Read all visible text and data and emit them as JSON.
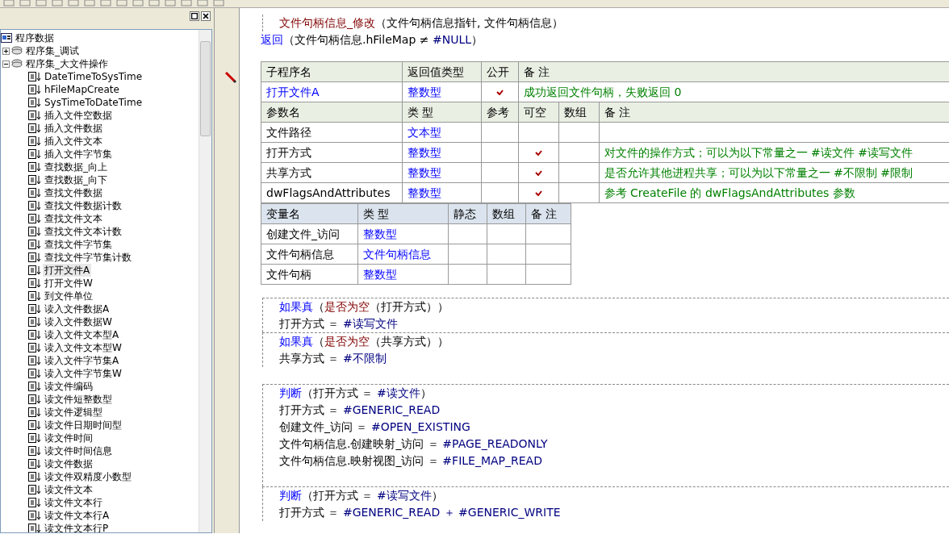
{
  "tree": {
    "label": "程序数据",
    "children": [
      {
        "label": "程序集_调试",
        "expanded": false
      },
      {
        "label": "程序集_大文件操作",
        "expanded": true,
        "children": [
          {
            "label": "DateTimeToSysTime",
            "selected": false
          },
          {
            "label": "hFileMapCreate",
            "selected": false
          },
          {
            "label": "SysTimeToDateTime",
            "selected": false
          },
          {
            "label": "插入文件空数据",
            "selected": false
          },
          {
            "label": "插入文件数据",
            "selected": false
          },
          {
            "label": "插入文件文本",
            "selected": false
          },
          {
            "label": "插入文件字节集",
            "selected": false
          },
          {
            "label": "查找数据_向上",
            "selected": false
          },
          {
            "label": "查找数据_向下",
            "selected": false
          },
          {
            "label": "查找文件数据",
            "selected": false
          },
          {
            "label": "查找文件数据计数",
            "selected": false
          },
          {
            "label": "查找文件文本",
            "selected": false
          },
          {
            "label": "查找文件文本计数",
            "selected": false
          },
          {
            "label": "查找文件字节集",
            "selected": false
          },
          {
            "label": "查找文件字节集计数",
            "selected": false
          },
          {
            "label": "打开文件A",
            "selected": true
          },
          {
            "label": "打开文件W",
            "selected": false
          },
          {
            "label": "到文件单位",
            "selected": false
          },
          {
            "label": "读入文件数据A",
            "selected": false
          },
          {
            "label": "读入文件数据W",
            "selected": false
          },
          {
            "label": "读入文件文本型A",
            "selected": false
          },
          {
            "label": "读入文件文本型W",
            "selected": false
          },
          {
            "label": "读入文件字节集A",
            "selected": false
          },
          {
            "label": "读入文件字节集W",
            "selected": false
          },
          {
            "label": "读文件编码",
            "selected": false
          },
          {
            "label": "读文件短整数型",
            "selected": false
          },
          {
            "label": "读文件逻辑型",
            "selected": false
          },
          {
            "label": "读文件日期时间型",
            "selected": false
          },
          {
            "label": "读文件时间",
            "selected": false
          },
          {
            "label": "读文件时间信息",
            "selected": false
          },
          {
            "label": "读文件数据",
            "selected": false
          },
          {
            "label": "读文件双精度小数型",
            "selected": false
          },
          {
            "label": "读文件文本",
            "selected": false
          },
          {
            "label": "读文件文本行",
            "selected": false
          },
          {
            "label": "读文件文本行A",
            "selected": false
          },
          {
            "label": "读文件文本行P",
            "selected": false
          }
        ]
      }
    ]
  },
  "code_top": [
    {
      "kind": "block",
      "children": [
        {
          "kind": "line",
          "parts": [
            {
              "text": "文件句柄信息_修改",
              "kind": "function"
            },
            {
              "text": "（文件句柄信息指针, 文件句柄信息）",
              "kind": "plain"
            }
          ]
        }
      ]
    },
    {
      "kind": "line",
      "parts": [
        {
          "text": "返回",
          "kind": "keyword"
        },
        {
          "text": "（文件句柄信息.hFileMap ≠ ",
          "kind": "plain"
        },
        {
          "text": "#NULL",
          "kind": "constant"
        },
        {
          "text": "）",
          "kind": "plain"
        }
      ]
    }
  ],
  "subroutine": {
    "columns": [
      "子程序名",
      "返回值类型",
      "公开",
      "备 注"
    ],
    "name": "打开文件A",
    "return_type": "整数型",
    "public": true,
    "comment": "成功返回文件句柄，失败返回 0"
  },
  "parameters": {
    "columns": [
      "参数名",
      "类 型",
      "参考",
      "可空",
      "数组",
      "备 注"
    ],
    "rows": [
      {
        "name": "文件路径",
        "type": "文本型",
        "by_ref": false,
        "nullable": false,
        "array": false
      },
      {
        "name": "打开方式",
        "type": "整数型",
        "by_ref": false,
        "nullable": true,
        "array": false,
        "comment": "对文件的操作方式；可以为以下常量之一 #读文件 #读写文件"
      },
      {
        "name": "共享方式",
        "type": "整数型",
        "by_ref": false,
        "nullable": true,
        "array": false,
        "comment": "是否允许其他进程共享；可以为以下常量之一 #不限制 #限制"
      },
      {
        "name": "dwFlagsAndAttributes",
        "type": "整数型",
        "by_ref": false,
        "nullable": true,
        "array": false,
        "comment": "参考 CreateFile 的 dwFlagsAndAttributes 参数"
      }
    ]
  },
  "variables": {
    "columns": [
      "变量名",
      "类 型",
      "静态",
      "数组",
      "备 注"
    ],
    "rows": [
      {
        "name": "创建文件_访问",
        "type": "整数型"
      },
      {
        "name": "文件句柄信息",
        "type": "文件句柄信息"
      },
      {
        "name": "文件句柄",
        "type": "整数型"
      }
    ]
  },
  "code_main": [
    {
      "kind": "block",
      "head": [
        {
          "text": "如果真",
          "kind": "keyword"
        },
        {
          "text": "（",
          "kind": "plain"
        },
        {
          "text": "是否为空",
          "kind": "function"
        },
        {
          "text": "（打开方式））",
          "kind": "plain"
        }
      ],
      "children": [
        {
          "kind": "line",
          "parts": [
            {
              "text": "打开方式 ＝ ",
              "kind": "plain"
            },
            {
              "text": "#读写文件",
              "kind": "constant"
            }
          ]
        }
      ]
    },
    {
      "kind": "block",
      "head": [
        {
          "text": "如果真",
          "kind": "keyword"
        },
        {
          "text": "（",
          "kind": "plain"
        },
        {
          "text": "是否为空",
          "kind": "function"
        },
        {
          "text": "（共享方式））",
          "kind": "plain"
        }
      ],
      "children": [
        {
          "kind": "line",
          "parts": [
            {
              "text": "共享方式 ＝ ",
              "kind": "plain"
            },
            {
              "text": "#不限制",
              "kind": "constant"
            }
          ]
        }
      ]
    },
    {
      "kind": "blank"
    },
    {
      "kind": "block",
      "head": [
        {
          "text": "判断",
          "kind": "keyword"
        },
        {
          "text": "（打开方式 ＝ ",
          "kind": "plain"
        },
        {
          "text": "#读文件",
          "kind": "constant"
        },
        {
          "text": "）",
          "kind": "plain"
        }
      ],
      "children": [
        {
          "kind": "line",
          "parts": [
            {
              "text": "打开方式 ＝ ",
              "kind": "plain"
            },
            {
              "text": "#GENERIC_READ",
              "kind": "constant"
            }
          ]
        },
        {
          "kind": "line",
          "parts": [
            {
              "text": "创建文件_访问 ＝ ",
              "kind": "plain"
            },
            {
              "text": "#OPEN_EXISTING",
              "kind": "constant"
            }
          ]
        },
        {
          "kind": "line",
          "parts": [
            {
              "text": "文件句柄信息.创建映射_访问 ＝ ",
              "kind": "plain"
            },
            {
              "text": "#PAGE_READONLY",
              "kind": "constant"
            }
          ]
        },
        {
          "kind": "line",
          "parts": [
            {
              "text": "文件句柄信息.映射视图_访问 ＝ ",
              "kind": "plain"
            },
            {
              "text": "#FILE_MAP_READ",
              "kind": "constant"
            }
          ]
        },
        {
          "kind": "blank"
        }
      ]
    },
    {
      "kind": "block",
      "head": [
        {
          "text": "判断",
          "kind": "keyword"
        },
        {
          "text": "（打开方式 ＝ ",
          "kind": "plain"
        },
        {
          "text": "#读写文件",
          "kind": "constant"
        },
        {
          "text": "）",
          "kind": "plain"
        }
      ],
      "children": [
        {
          "kind": "line",
          "parts": [
            {
              "text": "打开方式 ＝ ",
              "kind": "plain"
            },
            {
              "text": "#GENERIC_READ ＋ #GENERIC_WRITE",
              "kind": "constant"
            }
          ]
        }
      ]
    }
  ]
}
